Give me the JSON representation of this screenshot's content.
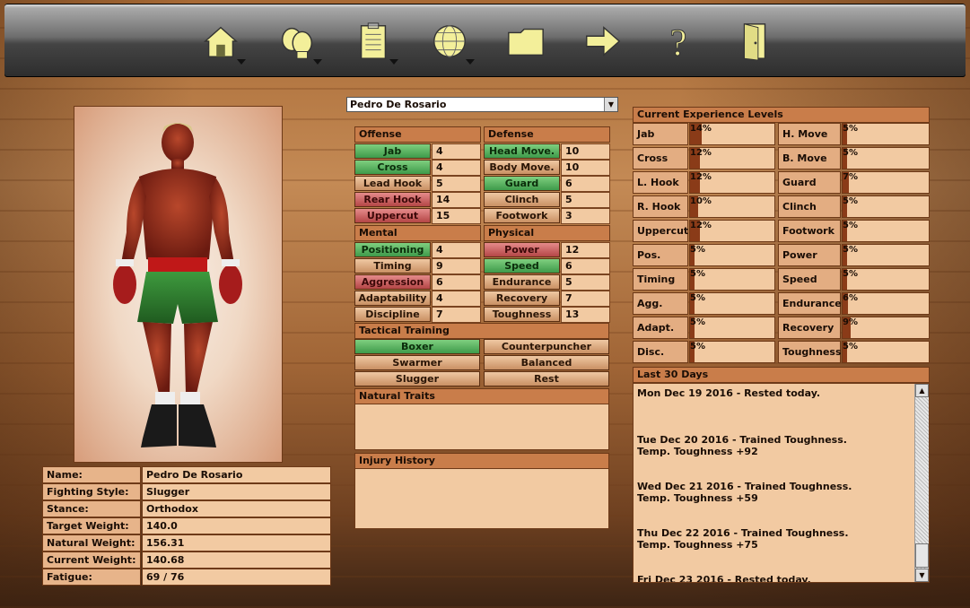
{
  "toolbar": {
    "items": [
      {
        "icon": "home-icon",
        "has_menu": true
      },
      {
        "icon": "boxing-gloves-icon",
        "has_menu": true
      },
      {
        "icon": "clipboard-icon",
        "has_menu": true
      },
      {
        "icon": "globe-icon",
        "has_menu": true
      },
      {
        "icon": "folder-icon",
        "has_menu": false
      },
      {
        "icon": "arrow-right-icon",
        "has_menu": false
      },
      {
        "icon": "help-icon",
        "has_menu": false
      },
      {
        "icon": "exit-door-icon",
        "has_menu": false
      }
    ]
  },
  "fighter_select": {
    "value": "Pedro De Rosario"
  },
  "info": {
    "name_label": "Name:",
    "name": "Pedro De Rosario",
    "style_label": "Fighting Style:",
    "style": "Slugger",
    "stance_label": "Stance:",
    "stance": "Orthodox",
    "target_label": "Target Weight:",
    "target": "140.0",
    "natural_label": "Natural Weight:",
    "natural": "156.31",
    "current_label": "Current Weight:",
    "current": "140.68",
    "fatigue_label": "Fatigue:",
    "fatigue": "69 / 76"
  },
  "offense": {
    "header": "Offense",
    "rows": [
      {
        "label": "Jab",
        "value": "4",
        "color": "green"
      },
      {
        "label": "Cross",
        "value": "4",
        "color": "green"
      },
      {
        "label": "Lead Hook",
        "value": "5",
        "color": "neutral"
      },
      {
        "label": "Rear Hook",
        "value": "14",
        "color": "red"
      },
      {
        "label": "Uppercut",
        "value": "15",
        "color": "red"
      }
    ]
  },
  "defense": {
    "header": "Defense",
    "rows": [
      {
        "label": "Head Move.",
        "value": "10",
        "color": "green"
      },
      {
        "label": "Body Move.",
        "value": "10",
        "color": "neutral"
      },
      {
        "label": "Guard",
        "value": "6",
        "color": "green"
      },
      {
        "label": "Clinch",
        "value": "5",
        "color": "neutral"
      },
      {
        "label": "Footwork",
        "value": "3",
        "color": "neutral"
      }
    ]
  },
  "mental": {
    "header": "Mental",
    "rows": [
      {
        "label": "Positioning",
        "value": "4",
        "color": "green"
      },
      {
        "label": "Timing",
        "value": "9",
        "color": "neutral"
      },
      {
        "label": "Aggression",
        "value": "6",
        "color": "red"
      },
      {
        "label": "Adaptability",
        "value": "4",
        "color": "neutral"
      },
      {
        "label": "Discipline",
        "value": "7",
        "color": "neutral"
      }
    ]
  },
  "physical": {
    "header": "Physical",
    "rows": [
      {
        "label": "Power",
        "value": "12",
        "color": "red"
      },
      {
        "label": "Speed",
        "value": "6",
        "color": "green"
      },
      {
        "label": "Endurance",
        "value": "5",
        "color": "neutral"
      },
      {
        "label": "Recovery",
        "value": "7",
        "color": "neutral"
      },
      {
        "label": "Toughness",
        "value": "13",
        "color": "neutral"
      }
    ]
  },
  "tactical": {
    "header": "Tactical Training",
    "options": [
      {
        "label": "Boxer",
        "selected": true
      },
      {
        "label": "Counterpuncher",
        "selected": false
      },
      {
        "label": "Swarmer",
        "selected": false
      },
      {
        "label": "Balanced",
        "selected": false
      },
      {
        "label": "Slugger",
        "selected": false
      },
      {
        "label": "Rest",
        "selected": false
      }
    ]
  },
  "traits": {
    "header": "Natural Traits"
  },
  "injury": {
    "header": "Injury History"
  },
  "experience": {
    "header": "Current Experience Levels",
    "left": [
      {
        "label": "Jab",
        "value": "14%",
        "fraction": 0.14
      },
      {
        "label": "Cross",
        "value": "12%",
        "fraction": 0.12
      },
      {
        "label": "L. Hook",
        "value": "12%",
        "fraction": 0.12
      },
      {
        "label": "R. Hook",
        "value": "10%",
        "fraction": 0.1
      },
      {
        "label": "Uppercut",
        "value": "12%",
        "fraction": 0.12
      },
      {
        "label": "Pos.",
        "value": "5%",
        "fraction": 0.05
      },
      {
        "label": "Timing",
        "value": "5%",
        "fraction": 0.05
      },
      {
        "label": "Agg.",
        "value": "5%",
        "fraction": 0.05
      },
      {
        "label": "Adapt.",
        "value": "5%",
        "fraction": 0.05
      },
      {
        "label": "Disc.",
        "value": "5%",
        "fraction": 0.05
      }
    ],
    "right": [
      {
        "label": "H. Move",
        "value": "5%",
        "fraction": 0.05
      },
      {
        "label": "B. Move",
        "value": "5%",
        "fraction": 0.05
      },
      {
        "label": "Guard",
        "value": "7%",
        "fraction": 0.07
      },
      {
        "label": "Clinch",
        "value": "5%",
        "fraction": 0.05
      },
      {
        "label": "Footwork",
        "value": "5%",
        "fraction": 0.05
      },
      {
        "label": "Power",
        "value": "5%",
        "fraction": 0.05
      },
      {
        "label": "Speed",
        "value": "5%",
        "fraction": 0.05
      },
      {
        "label": "Endurance",
        "value": "6%",
        "fraction": 0.06
      },
      {
        "label": "Recovery",
        "value": "9%",
        "fraction": 0.09
      },
      {
        "label": "Toughness",
        "value": "5%",
        "fraction": 0.05
      }
    ]
  },
  "log": {
    "header": "Last 30 Days",
    "entries": [
      "Mon Dec 19 2016 - Rested today.",
      "Tue Dec 20 2016 - Trained Toughness.\nTemp. Toughness +92",
      "Wed Dec 21 2016 - Trained Toughness.\nTemp. Toughness +59",
      "Thu Dec 22 2016 - Trained Toughness.\nTemp. Toughness +75",
      "Fri Dec 23 2016 - Rested today."
    ]
  },
  "colors": {
    "green": "#3e9a4a",
    "red": "#b44646",
    "neutral": "#c99064",
    "header": "#c97d4a"
  }
}
